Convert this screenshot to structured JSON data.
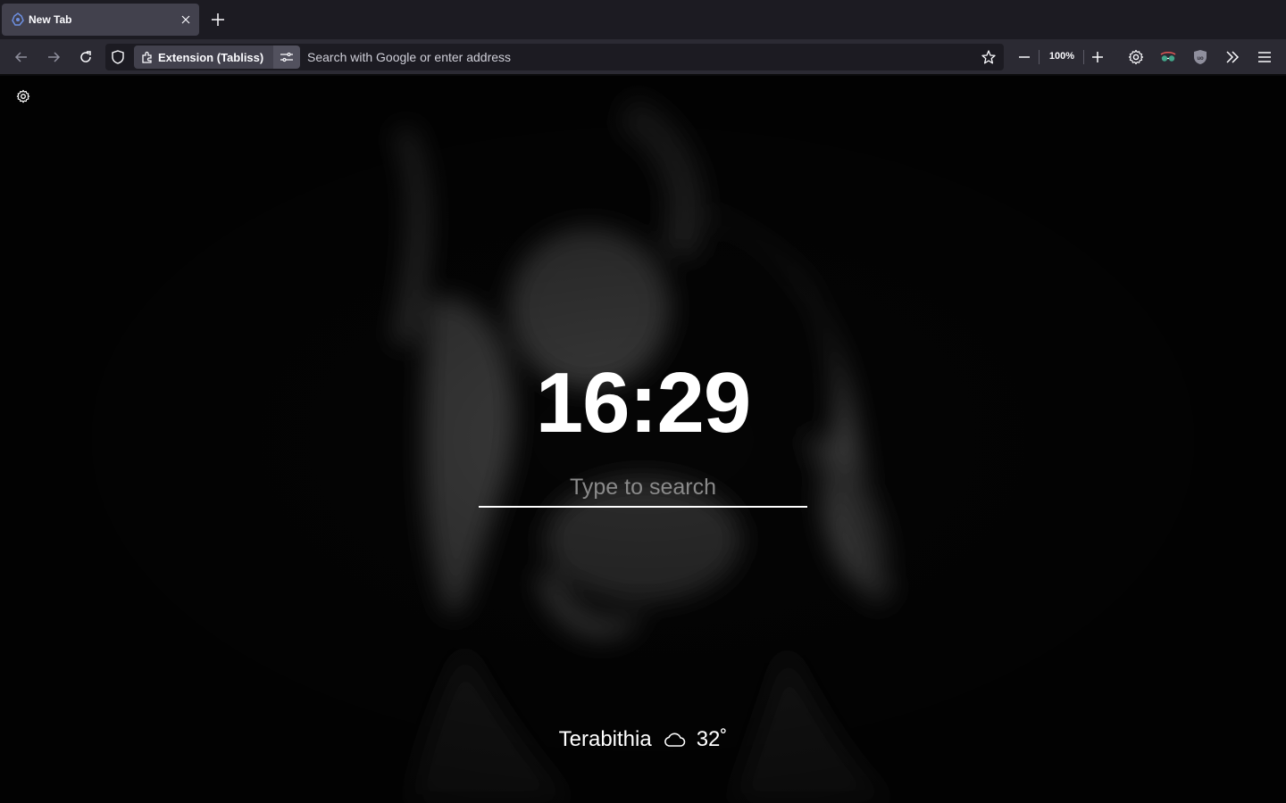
{
  "browser": {
    "tab": {
      "title": "New Tab",
      "close_icon": "close-icon",
      "favicon": "tabliss-icon"
    },
    "new_tab_icon": "plus-icon",
    "nav": {
      "back_icon": "arrow-left-icon",
      "forward_icon": "arrow-right-icon",
      "reload_icon": "reload-icon"
    },
    "urlbar": {
      "identity_chip_label": "Extension (Tabliss)",
      "placeholder": "Search with Google or enter address"
    },
    "zoom": {
      "level": "100%"
    },
    "toolbar_icons": [
      "gear-icon",
      "extension-glasses-icon",
      "ublock-icon",
      "overflow-chevrons-icon",
      "hamburger-menu-icon"
    ]
  },
  "page": {
    "clock": "16:29",
    "search_placeholder": "Type to search",
    "weather": {
      "location": "Terabithia",
      "condition_icon": "cloud-icon",
      "temperature": "32˚"
    }
  },
  "colors": {
    "tabstrip_bg": "#1c1b22",
    "tab_active_bg": "#42414d",
    "navbar_bg": "#2b2a33",
    "urlbar_bg": "#1c1b22",
    "page_bg": "#050505",
    "text_primary": "#ffffff"
  }
}
